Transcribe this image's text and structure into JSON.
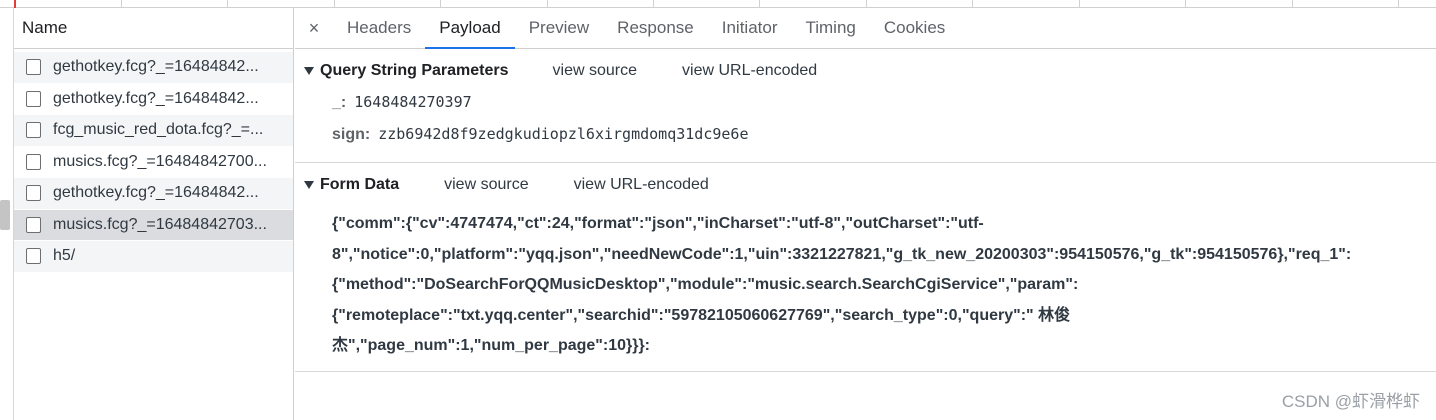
{
  "left_pane": {
    "column_header": "Name",
    "requests": [
      {
        "name": "gethotkey.fcg?_=16484842...",
        "selected": false
      },
      {
        "name": "gethotkey.fcg?_=16484842...",
        "selected": false
      },
      {
        "name": "fcg_music_red_dota.fcg?_=...",
        "selected": false
      },
      {
        "name": "musics.fcg?_=16484842700...",
        "selected": false
      },
      {
        "name": "gethotkey.fcg?_=16484842...",
        "selected": false
      },
      {
        "name": "musics.fcg?_=16484842703...",
        "selected": true
      },
      {
        "name": "h5/",
        "selected": false
      }
    ]
  },
  "tabs": {
    "close_icon": "×",
    "items": [
      "Headers",
      "Payload",
      "Preview",
      "Response",
      "Initiator",
      "Timing",
      "Cookies"
    ],
    "active": "Payload"
  },
  "query_section": {
    "title": "Query String Parameters",
    "view_source": "view source",
    "view_url_encoded": "view URL-encoded",
    "params": [
      {
        "key": "_:",
        "value": "1648484270397"
      },
      {
        "key": "sign:",
        "value": "zzb6942d8f9zedgkudiopzl6xirgmdomq31dc9e6e"
      }
    ]
  },
  "form_section": {
    "title": "Form Data",
    "view_source": "view source",
    "view_url_encoded": "view URL-encoded",
    "lines": [
      "{\"comm\":{\"cv\":4747474,\"ct\":24,\"format\":\"json\",\"inCharset\":\"utf-8\",\"outCharset\":\"utf-",
      "8\",\"notice\":0,\"platform\":\"yqq.json\",\"needNewCode\":1,\"uin\":3321227821,\"g_tk_new_20200303\":954150576,\"g_tk\":954150576},\"req_1\":",
      "{\"method\":\"DoSearchForQQMusicDesktop\",\"module\":\"music.search.SearchCgiService\",\"param\":",
      "{\"remoteplace\":\"txt.yqq.center\",\"searchid\":\"59782105060627769\",\"search_type\":0,\"query\":\" 林俊",
      "杰\",\"page_num\":1,\"num_per_page\":10}}}:"
    ]
  },
  "watermark": "CSDN @虾滑桦虾",
  "colors": {
    "accent": "#1a73e8",
    "text": "#303942",
    "selected_row": "#dadce0"
  }
}
